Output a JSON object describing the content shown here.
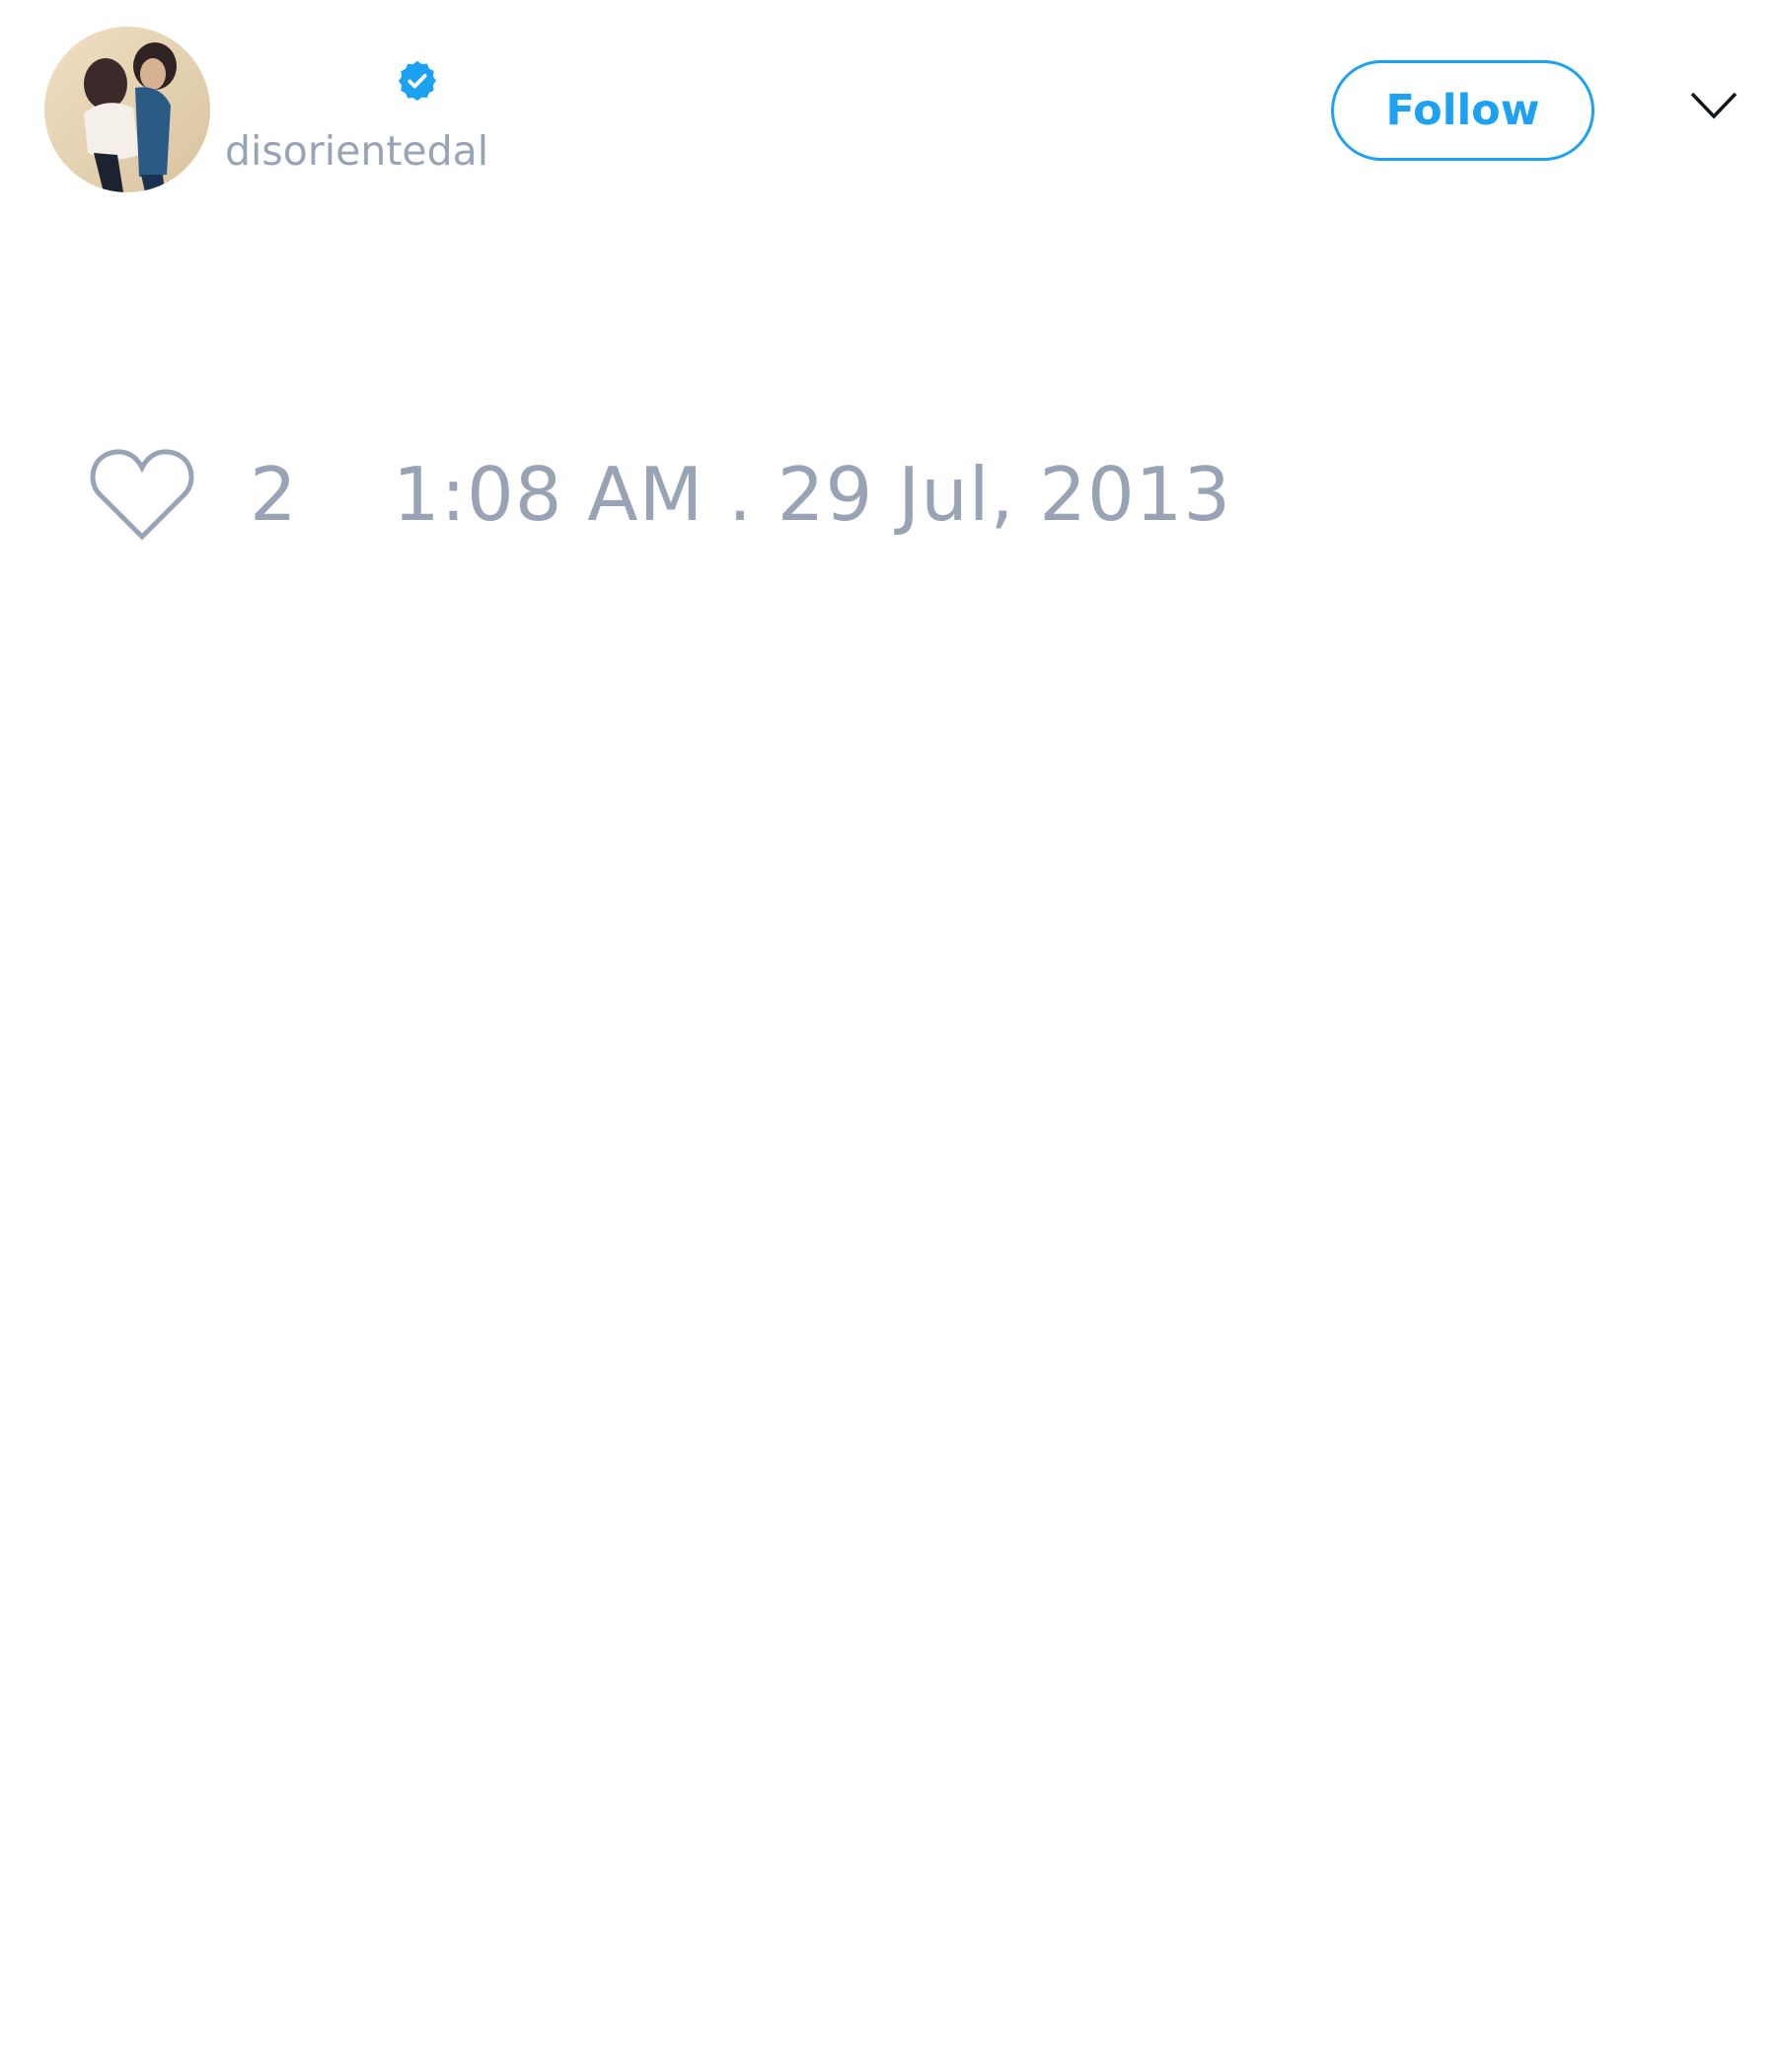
{
  "tweet": {
    "author": {
      "handle": "disorientedal",
      "verified": true
    },
    "follow_label": "Follow",
    "likes": "2",
    "timestamp": "1:08 AM . 29 Jul, 2013"
  },
  "icons": {
    "verified": "verified-badge-icon",
    "menu": "chevron-down-icon",
    "like": "heart-icon"
  },
  "colors": {
    "accent": "#1da1f2",
    "muted_text": "#98a3b6"
  }
}
